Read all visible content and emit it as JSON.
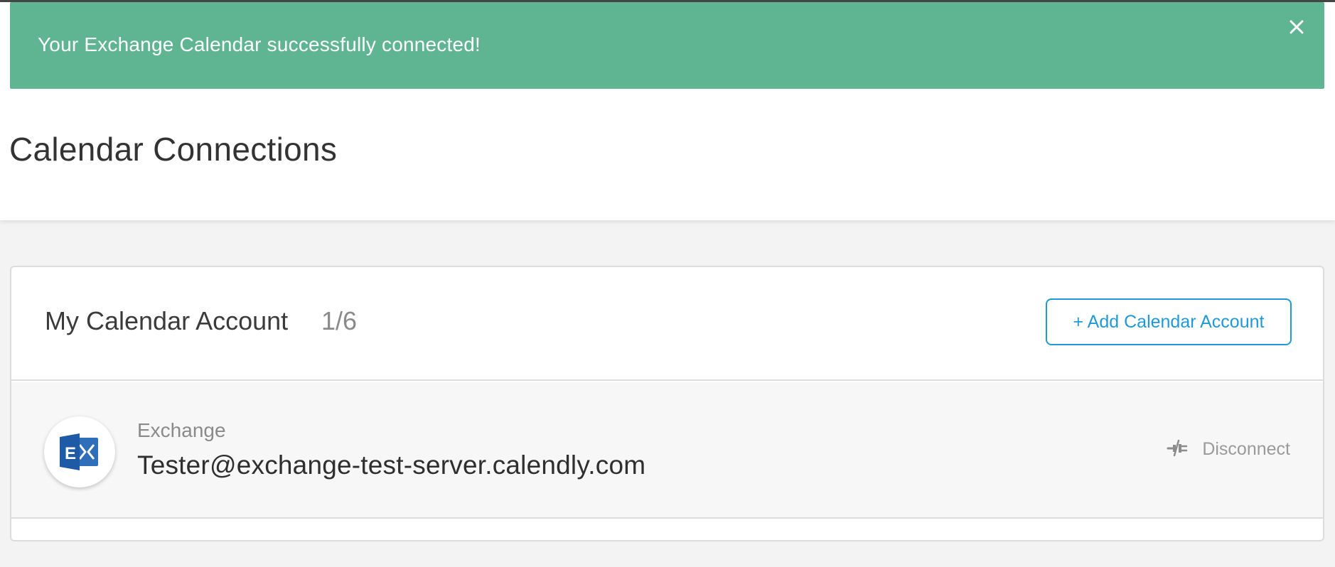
{
  "notification": {
    "message": "Your Exchange Calendar successfully connected!",
    "close_icon": "close-icon",
    "background_color": "#5fb591"
  },
  "page": {
    "title": "Calendar Connections"
  },
  "calendar_section": {
    "title": "My Calendar Account",
    "count": "1/6",
    "add_button_label": "+ Add Calendar Account",
    "accent_color": "#1f9ad6"
  },
  "accounts": [
    {
      "provider": "Exchange",
      "provider_icon": "exchange-icon",
      "email": "Tester@exchange-test-server.calendly.com",
      "disconnect_label": "Disconnect",
      "disconnect_icon": "unplug-icon"
    }
  ]
}
